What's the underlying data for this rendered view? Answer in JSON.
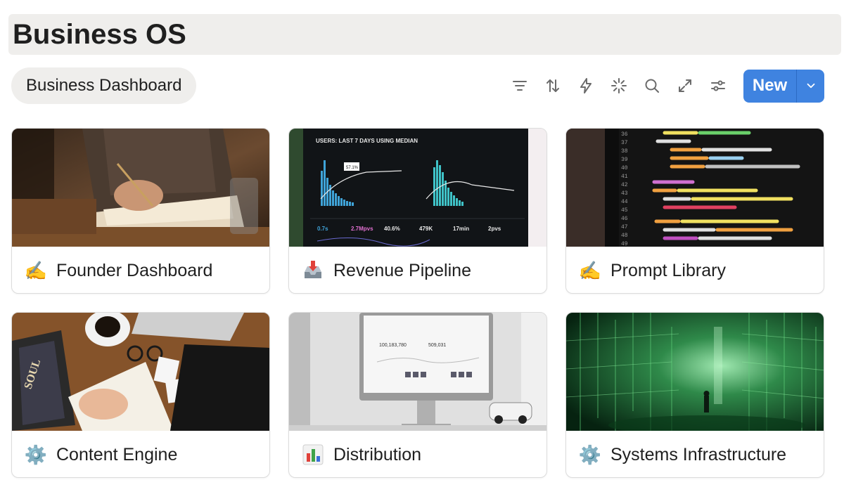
{
  "page": {
    "title": "Business OS"
  },
  "view": {
    "tab_label": "Business Dashboard"
  },
  "toolbar": {
    "icons": [
      "filter-icon",
      "sort-icon",
      "automation-bolt-icon",
      "sparkle-ai-icon",
      "search-icon",
      "expand-icon",
      "settings-sliders-icon"
    ],
    "new_label": "New",
    "accent": "#3f83e0"
  },
  "cards": [
    {
      "title": "Founder Dashboard",
      "icon": "writing-hand-icon",
      "cover": "desk-writing-photo"
    },
    {
      "title": "Revenue Pipeline",
      "icon": "inbox-tray-icon",
      "cover": "analytics-monitor-photo",
      "cover_text": {
        "header": "USERS: LAST 7 DAYS USING MEDIAN",
        "callout": "57.1%",
        "stats": [
          "0.7s",
          "2.7Mpvs",
          "40.6%",
          "479K",
          "17min",
          "2pvs"
        ]
      }
    },
    {
      "title": "Prompt Library",
      "icon": "writing-hand-icon",
      "cover": "code-editor-photo"
    },
    {
      "title": "Content Engine",
      "icon": "gear-icon",
      "cover": "desk-flatlay-photo",
      "cover_text": {
        "book": "SOUL"
      }
    },
    {
      "title": "Distribution",
      "icon": "bar-chart-icon",
      "cover": "imac-dashboard-photo",
      "cover_text": {
        "metric_a": "100,183,780",
        "metric_b": "509,031"
      }
    },
    {
      "title": "Systems Infrastructure",
      "icon": "gear-icon",
      "cover": "green-matrix-city-art"
    }
  ]
}
